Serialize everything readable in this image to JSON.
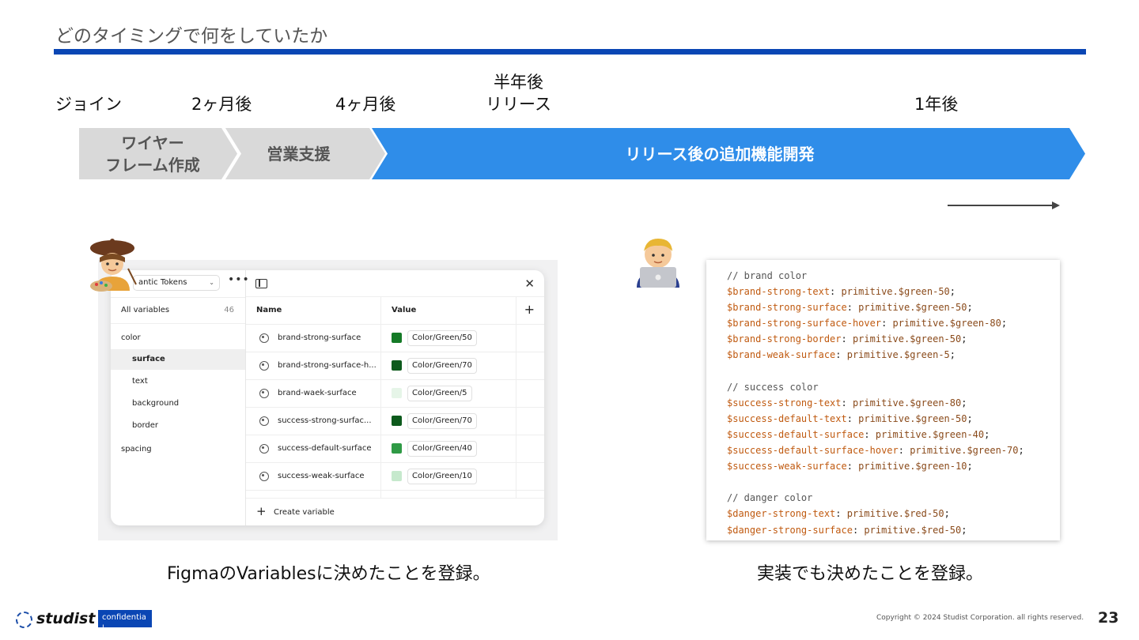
{
  "slide": {
    "title": "どのタイミングで何をしていたか",
    "accent_color": "#0a46b4"
  },
  "timeline": {
    "milestones": [
      {
        "label": "ジョイン"
      },
      {
        "label": "2ヶ月後"
      },
      {
        "label": "4ヶ月後"
      },
      {
        "label": "半年後\nリリース"
      },
      {
        "label": "1年後"
      }
    ],
    "phases": [
      {
        "label": "ワイヤー\nフレーム作成",
        "color": "#d9d9d9"
      },
      {
        "label": "営業支援",
        "color": "#d9d9d9"
      },
      {
        "label": "リリース後の追加機能開発",
        "color": "#2f8de9"
      }
    ]
  },
  "figma": {
    "collection_label": "antic Tokens",
    "all_variables_label": "All variables",
    "all_variables_count": "46",
    "groups": [
      {
        "label": "color",
        "children": [
          "surface",
          "text",
          "background",
          "border"
        ],
        "selected": "surface"
      },
      {
        "label": "spacing",
        "children": []
      }
    ],
    "columns": {
      "name": "Name",
      "value": "Value"
    },
    "rows": [
      {
        "name": "brand-strong-surface",
        "value": "Color/Green/50",
        "swatch": "#157a27"
      },
      {
        "name": "brand-strong-surface-h...",
        "value": "Color/Green/70",
        "swatch": "#0d5a1c"
      },
      {
        "name": "brand-waek-surface",
        "value": "Color/Green/5",
        "swatch": "#e6f5e8"
      },
      {
        "name": "success-strong-surfac...",
        "value": "Color/Green/70",
        "swatch": "#0d5a1c"
      },
      {
        "name": "success-default-surface",
        "value": "Color/Green/40",
        "swatch": "#2f9a45"
      },
      {
        "name": "success-weak-surface",
        "value": "Color/Green/10",
        "swatch": "#c6e9cd"
      }
    ],
    "create_label": "Create variable"
  },
  "avatars": {
    "artist": "artist-avatar-icon",
    "developer": "developer-avatar-icon"
  },
  "code": {
    "lines": [
      {
        "type": "comment",
        "text": "// brand color"
      },
      {
        "type": "decl",
        "var": "$brand-strong-text",
        "value": "primitive.$green-50"
      },
      {
        "type": "decl",
        "var": "$brand-strong-surface",
        "value": "primitive.$green-50"
      },
      {
        "type": "decl",
        "var": "$brand-strong-surface-hover",
        "value": "primitive.$green-80"
      },
      {
        "type": "decl",
        "var": "$brand-strong-border",
        "value": "primitive.$green-50"
      },
      {
        "type": "decl",
        "var": "$brand-weak-surface",
        "value": "primitive.$green-5"
      },
      {
        "type": "blank",
        "text": ""
      },
      {
        "type": "comment",
        "text": "// success color"
      },
      {
        "type": "decl",
        "var": "$success-strong-text",
        "value": "primitive.$green-80"
      },
      {
        "type": "decl",
        "var": "$success-default-text",
        "value": "primitive.$green-50"
      },
      {
        "type": "decl",
        "var": "$success-default-surface",
        "value": "primitive.$green-40"
      },
      {
        "type": "decl",
        "var": "$success-default-surface-hover",
        "value": "primitive.$green-70"
      },
      {
        "type": "decl",
        "var": "$success-weak-surface",
        "value": "primitive.$green-10"
      },
      {
        "type": "blank",
        "text": ""
      },
      {
        "type": "comment",
        "text": "// danger color"
      },
      {
        "type": "decl",
        "var": "$danger-strong-text",
        "value": "primitive.$red-50"
      },
      {
        "type": "decl",
        "var": "$danger-strong-surface",
        "value": "primitive.$red-50"
      }
    ]
  },
  "captions": {
    "left": "FigmaのVariablesに決めたことを登録。",
    "right": "実装でも決めたことを登録。"
  },
  "footer": {
    "logo": "studist",
    "badge": "confidentia\nl",
    "copyright": "Copyright © 2024 Studist Corporation. all rights reserved.",
    "page": "23"
  }
}
